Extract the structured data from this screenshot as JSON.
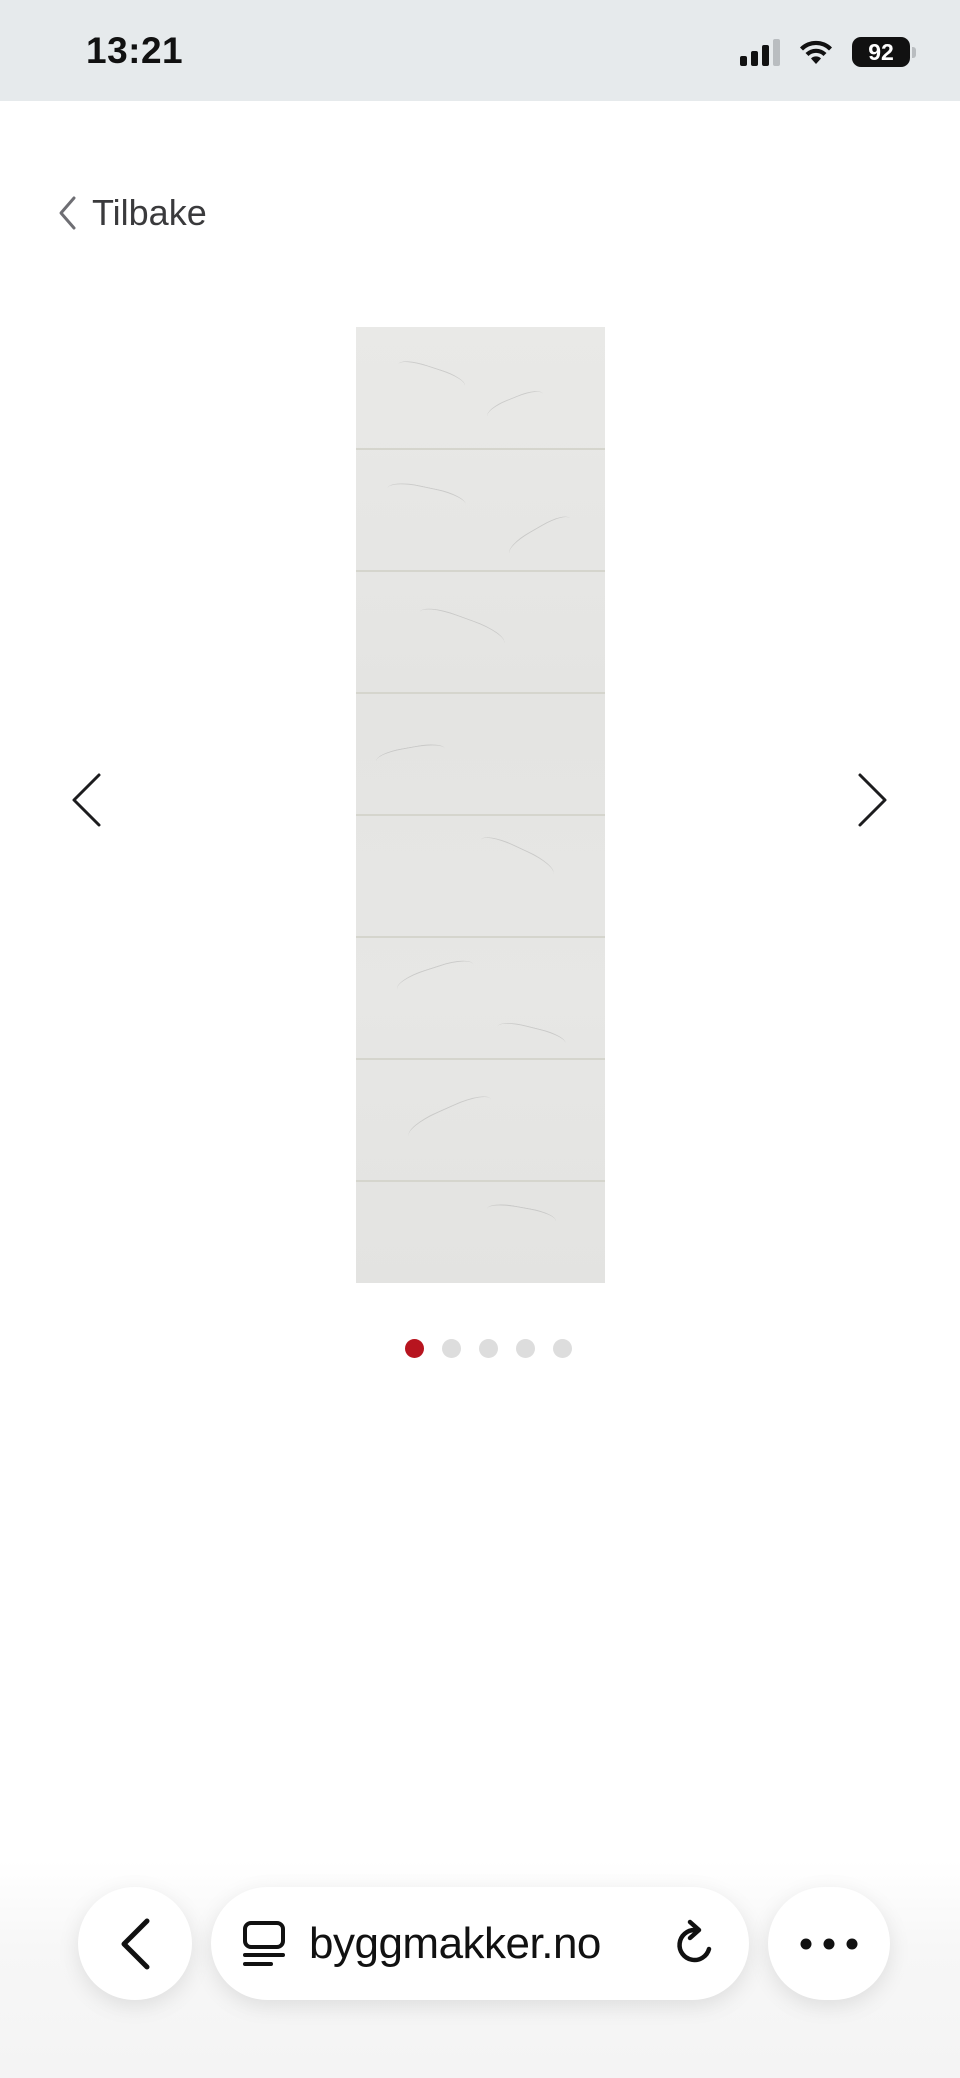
{
  "status_bar": {
    "time": "13:21",
    "battery": "92",
    "signal_icon": "cellular-signal-icon",
    "wifi_icon": "wifi-icon"
  },
  "nav": {
    "back_label": "Tilbake",
    "back_icon": "chevron-left-icon"
  },
  "gallery": {
    "image_description_icon": "product-image",
    "prev_icon": "chevron-left-icon",
    "next_icon": "chevron-right-icon",
    "slide_count": 5,
    "active_index": 0,
    "active_color": "#b7141f",
    "inactive_color": "#dddddd"
  },
  "browser": {
    "url": "byggmakker.no",
    "back_icon": "chevron-left-icon",
    "tabs_icon": "tabs-icon",
    "reload_icon": "reload-icon",
    "more_icon": "more-icon"
  }
}
